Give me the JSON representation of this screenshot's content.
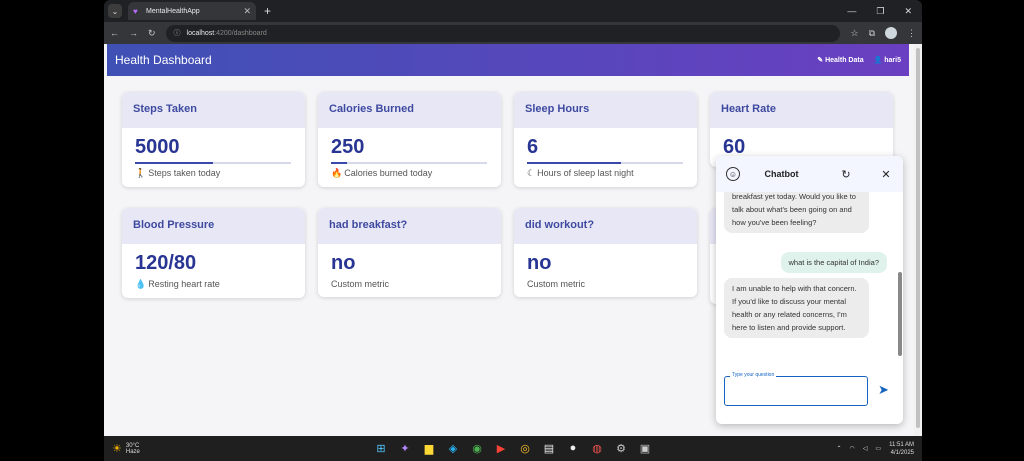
{
  "browser": {
    "tab_title": "MentalHealthApp",
    "url_host": "localhost",
    "url_path": ":4200/dashboard"
  },
  "appbar": {
    "title": "Health Dashboard",
    "health_data": "Health Data",
    "user": "hari5"
  },
  "cards": [
    {
      "title": "Steps Taken",
      "value": "5000",
      "sub": "Steps taken today",
      "icon": "walk-icon",
      "progress": 0.5
    },
    {
      "title": "Calories Burned",
      "value": "250",
      "sub": "Calories burned today",
      "icon": "fire-icon",
      "progress": 0.1
    },
    {
      "title": "Sleep Hours",
      "value": "6",
      "sub": "Hours of sleep last night",
      "icon": "moon-icon",
      "progress": 0.6
    },
    {
      "title": "Heart Rate",
      "value": "60",
      "sub": "",
      "icon": "",
      "progress": 0
    },
    {
      "title": "Blood Pressure",
      "value": "120/80",
      "sub": "Resting heart rate",
      "icon": "drop-icon"
    },
    {
      "title": "had breakfast?",
      "value": "no",
      "sub": "Custom metric"
    },
    {
      "title": "did workout?",
      "value": "no",
      "sub": "Custom metric"
    }
  ],
  "chat": {
    "title": "Chatbot",
    "messages": [
      {
        "role": "bot",
        "text": "breakfast yet today. Would you like to talk about what's been going on and how you've been feeling?"
      },
      {
        "role": "user",
        "text": "what is the capital of India?"
      },
      {
        "role": "bot",
        "text": "I am unable to help with that concern. If you'd like to discuss your mental health or any related concerns, I'm here to listen and provide support."
      }
    ],
    "input_label": "Type your question"
  },
  "taskbar": {
    "temp": "30°C",
    "weather": "Haze",
    "time": "11:51 AM",
    "date": "4/1/2025"
  },
  "colors": {
    "appbar_start": "#3f51b5",
    "appbar_end": "#6a3fc1",
    "card_head": "#e8e7f6",
    "value": "#283593"
  }
}
